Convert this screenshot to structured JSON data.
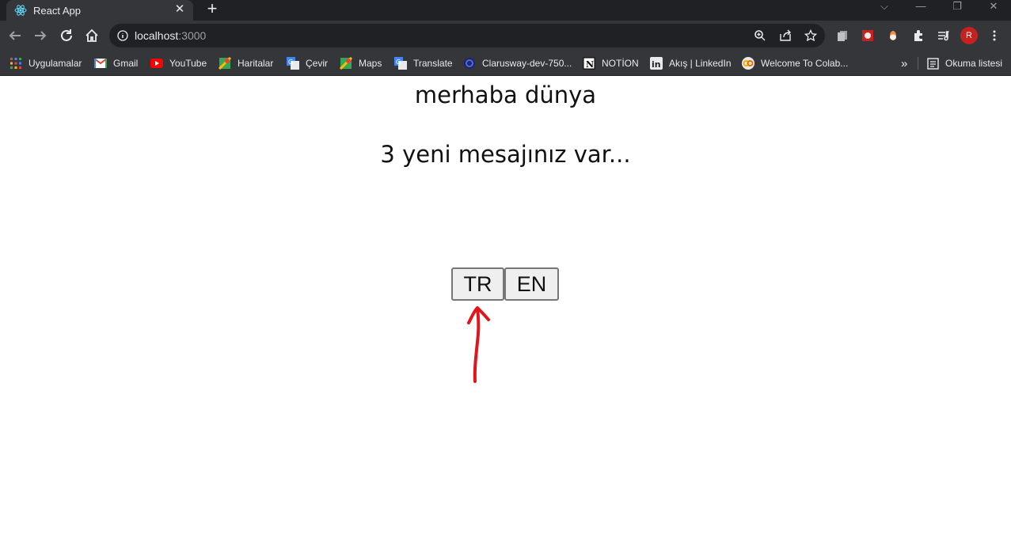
{
  "browser": {
    "tab": {
      "title": "React App",
      "favicon": "react-logo-icon",
      "close_glyph": "✕"
    },
    "new_tab_glyph": "+",
    "window_controls": {
      "collapse": "⌵",
      "minimize": "—",
      "restore": "❐",
      "close": "✕"
    },
    "address": {
      "host": "localhost",
      "port": ":3000",
      "info_icon": "info-icon"
    },
    "profile_initial": "R"
  },
  "bookmarks": [
    {
      "label": "Uygulamalar",
      "icon": "apps-grid-icon"
    },
    {
      "label": "Gmail",
      "icon": "gmail-icon"
    },
    {
      "label": "YouTube",
      "icon": "youtube-icon"
    },
    {
      "label": "Haritalar",
      "icon": "maps-icon"
    },
    {
      "label": "Çevir",
      "icon": "translate-icon"
    },
    {
      "label": "Maps",
      "icon": "maps-icon"
    },
    {
      "label": "Translate",
      "icon": "translate-icon"
    },
    {
      "label": "Clarusway-dev-750...",
      "icon": "clarusway-icon"
    },
    {
      "label": "NOTİON",
      "icon": "notion-icon"
    },
    {
      "label": "Akış | LinkedIn",
      "icon": "linkedin-icon"
    },
    {
      "label": "Welcome To Colab...",
      "icon": "colab-icon"
    }
  ],
  "bookmarks_overflow": "»",
  "reading_list": {
    "label": "Okuma listesi",
    "icon": "reading-list-icon"
  },
  "page": {
    "greeting": "merhaba dünya",
    "messages": "3 yeni mesajınız var...",
    "buttons": {
      "tr": "TR",
      "en": "EN"
    },
    "annotation": {
      "color": "#e0161d",
      "icon": "hand-drawn-arrow-icon"
    }
  },
  "colors": {
    "chrome_dark": "#202124",
    "chrome_toolbar": "#35363a",
    "chrome_text": "#e8eaed",
    "button_bg": "#efefef",
    "button_border": "#767676"
  }
}
